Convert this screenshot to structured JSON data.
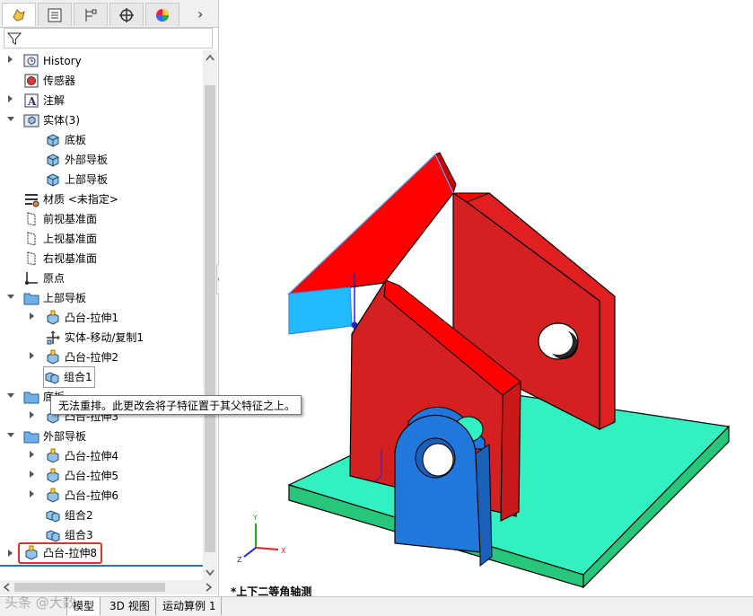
{
  "tabs": [
    {
      "icon": "feature-manager-icon"
    },
    {
      "icon": "property-manager-icon"
    },
    {
      "icon": "configuration-manager-icon"
    },
    {
      "icon": "dimxpert-icon"
    },
    {
      "icon": "display-manager-icon"
    }
  ],
  "expand_arrow": "›",
  "tree": {
    "history": "History",
    "sensors": "传感器",
    "annotations": "注解",
    "solid_bodies": "实体(3)",
    "body_base": "底板",
    "body_outer": "外部导板",
    "body_upper": "上部导板",
    "material": "材质 <未指定>",
    "front_plane": "前视基准面",
    "top_plane": "上视基准面",
    "right_plane": "右视基准面",
    "origin": "原点",
    "folder_upper": "上部导板",
    "boss1": "凸台-拉伸1",
    "move_copy1": "实体-移动/复制1",
    "boss2": "凸台-拉伸2",
    "combine1": "组合1",
    "folder_base": "底板",
    "boss3": "凸台-拉伸3",
    "folder_outer": "外部导板",
    "boss4": "凸台-拉伸4",
    "boss5": "凸台-拉伸5",
    "boss6": "凸台-拉伸6",
    "combine2": "组合2",
    "combine3": "组合3",
    "boss8": "凸台-拉伸8"
  },
  "tooltip": "无法重排。此更改会将子特征置于其父特征之上。",
  "bottom_tabs": [
    "模型",
    "3D 视图",
    "运动算例 1"
  ],
  "view_name": "*上下二等角轴测",
  "watermark": "头条 @大数...",
  "triad": {
    "x": "X",
    "y": "Y",
    "z": "Z"
  },
  "colors": {
    "roof_red": "#ff0000",
    "wall_red": "#d42020",
    "base_teal": "#33f0c0",
    "clevis_blue": "#2277dd",
    "selected_face": "#22bbff",
    "highlight_box": "#e03030"
  }
}
